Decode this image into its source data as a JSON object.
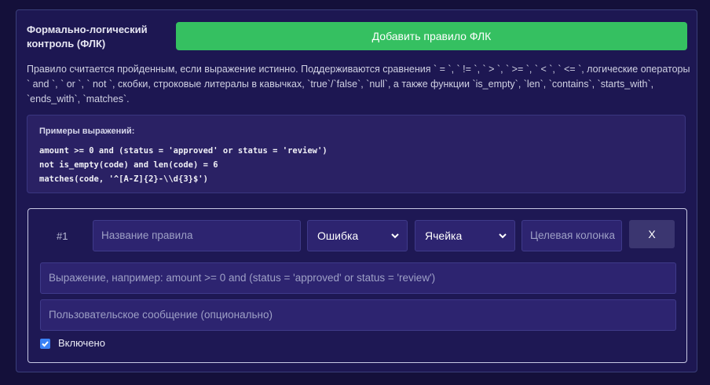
{
  "header": {
    "title": "Формально-логический контроль (ФЛК)",
    "add_button_label": "Добавить правило ФЛК"
  },
  "description": "Правило считается пройденным, если выражение истинно. Поддерживаются сравнения ` = `, ` != `, ` > `, ` >= `, ` < `, ` <= `, логические операторы ` and `, ` or `, ` not `, скобки, строковые литералы в кавычках, `true`/`false`, `null`, а также функции `is_empty`, `len`, `contains`, `starts_with`, `ends_with`, `matches`.",
  "examples": {
    "title": "Примеры выражений:",
    "lines": [
      "amount >= 0 and (status = 'approved' or status = 'review')",
      "not is_empty(code) and len(code) = 6",
      "matches(code, '^[A-Z]{2}-\\\\d{3}$')"
    ]
  },
  "rule": {
    "number": "#1",
    "name_placeholder": "Название правила",
    "severity_value": "Ошибка",
    "scope_value": "Ячейка",
    "target_column_placeholder": "Целевая колонка",
    "close_label": "X",
    "expression_placeholder": "Выражение, например: amount >= 0 and (status = 'approved' or status = 'review')",
    "message_placeholder": "Пользовательское сообщение (опционально)",
    "enabled_label": "Включено",
    "enabled": true
  },
  "colors": {
    "accent_green": "#35c061",
    "background": "#14103a",
    "panel": "#1d1752",
    "checkbox": "#3b82f6"
  }
}
